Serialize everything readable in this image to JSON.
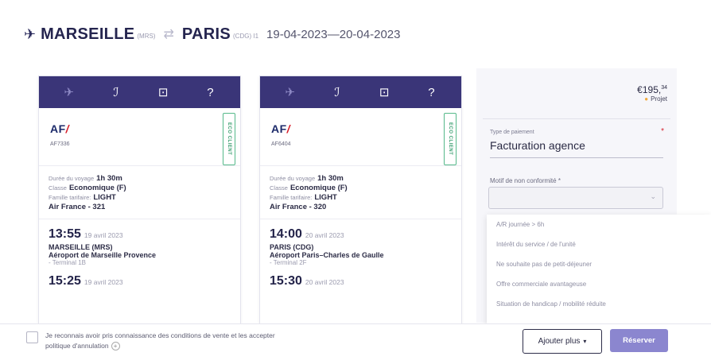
{
  "header": {
    "origin_city": "MARSEILLE",
    "origin_code": "(MRS)",
    "destination_city": "PARIS",
    "destination_code": "(CDG) ⅼ1",
    "dates": "19-04-2023—20-04-2023"
  },
  "cards": [
    {
      "airline_logo": "AF",
      "flight_number": "AF7336",
      "badge": "ECO CLIENT",
      "duration_label": "Durée du voyage",
      "duration": "1h 30m",
      "class_label": "Classe",
      "class_value": "Economique (F)",
      "fare_label": "Famille tarifaire:",
      "fare_value": "LIGHT",
      "aircraft": "Air France - 321",
      "dep_time": "13:55",
      "dep_date": "19 avril 2023",
      "dep_city": "MARSEILLE (MRS)",
      "dep_airport": "Aéroport de Marseille Provence",
      "dep_terminal": "- Terminal 1B",
      "arr_time": "15:25",
      "arr_date": "19 avril 2023"
    },
    {
      "airline_logo": "AF",
      "flight_number": "AF6404",
      "badge": "ECO CLIENT",
      "duration_label": "Durée du voyage",
      "duration": "1h 30m",
      "class_label": "Classe",
      "class_value": "Economique (F)",
      "fare_label": "Famille tarifaire:",
      "fare_value": "LIGHT",
      "aircraft": "Air France - 320",
      "dep_time": "14:00",
      "dep_date": "20 avril 2023",
      "dep_city": "PARIS (CDG)",
      "dep_airport": "Aéroport Paris–Charles de Gaulle",
      "dep_terminal": "- Terminal 2F",
      "arr_time": "15:30",
      "arr_date": "20 avril 2023"
    }
  ],
  "card_tabs": {
    "icons": [
      "plane-icon",
      "seat-icon",
      "luggage-icon",
      "help-icon"
    ],
    "glyphs": [
      "✈",
      "ℐ",
      "⊡",
      "?"
    ]
  },
  "panel": {
    "price": "€195,",
    "price_cents": "34",
    "status": "Projet",
    "status_color": "#f2a93b",
    "payment_label": "Type de paiement",
    "payment_required_mark": "*",
    "payment_value": "Facturation agence",
    "motif_label": "Motif de non conformité *"
  },
  "dropdown": {
    "options": [
      "A/R journée > 6h",
      "Intérêt du service / de l'unité",
      "Ne souhaite pas de petit-déjeuner",
      "Offre commerciale avantageuse",
      "Situation de handicap / mobilité réduite"
    ]
  },
  "footer": {
    "terms_text": "Je reconnais avoir pris connaissance des conditions de vente et les accepter",
    "terms_link": "politique d'annulation",
    "add_more_label": "Ajouter plus",
    "reserve_label": "Réserver"
  },
  "colors": {
    "card_header": "#3a3578",
    "reserve_button": "#8b86cf",
    "badge": "#3b9f70",
    "af_red": "#d6202b"
  }
}
